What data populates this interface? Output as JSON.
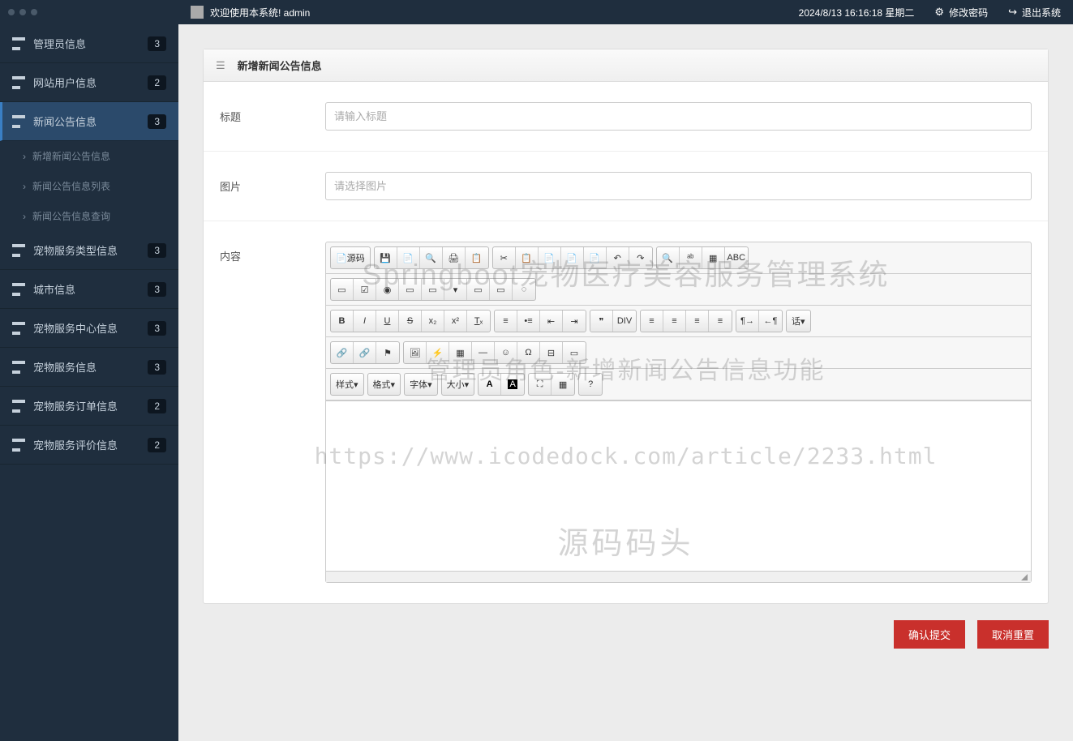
{
  "topbar": {
    "welcome": "欢迎使用本系统! admin",
    "datetime": "2024/8/13 16:16:18 星期二",
    "change_pwd": "修改密码",
    "logout": "退出系统"
  },
  "sidebar": {
    "items": [
      {
        "label": "管理员信息",
        "badge": "3"
      },
      {
        "label": "网站用户信息",
        "badge": "2"
      },
      {
        "label": "新闻公告信息",
        "badge": "3",
        "active": true
      },
      {
        "label": "宠物服务类型信息",
        "badge": "3"
      },
      {
        "label": "城市信息",
        "badge": "3"
      },
      {
        "label": "宠物服务中心信息",
        "badge": "3"
      },
      {
        "label": "宠物服务信息",
        "badge": "3"
      },
      {
        "label": "宠物服务订单信息",
        "badge": "2"
      },
      {
        "label": "宠物服务评价信息",
        "badge": "2"
      }
    ],
    "sub": [
      {
        "label": "新增新闻公告信息"
      },
      {
        "label": "新闻公告信息列表"
      },
      {
        "label": "新闻公告信息查询"
      }
    ]
  },
  "panel": {
    "title": "新增新闻公告信息",
    "label_title": "标题",
    "placeholder_title": "请输入标题",
    "label_image": "图片",
    "placeholder_image": "请选择图片",
    "label_content": "内容"
  },
  "editor": {
    "source": "源码",
    "style": "样式",
    "format": "格式",
    "font": "字体",
    "size": "大小",
    "lang": "话"
  },
  "actions": {
    "submit": "确认提交",
    "cancel": "取消重置"
  },
  "watermark": {
    "line1": "Springboot宠物医疗美容服务管理系统",
    "line2": "管理员角色-新增新闻公告信息功能",
    "line3": "https://www.icodedock.com/article/2233.html",
    "line4": "源码码头"
  }
}
